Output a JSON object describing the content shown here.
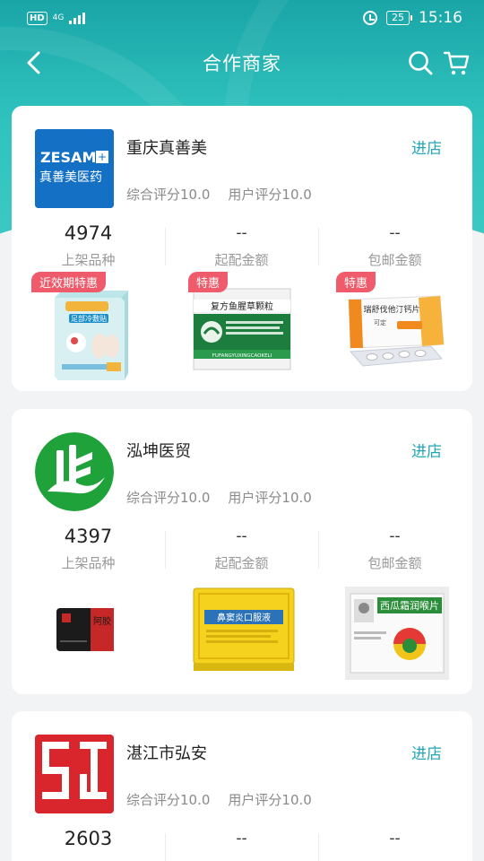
{
  "status_bar": {
    "hd": "HD",
    "network": "4G",
    "battery": "25",
    "time": "15:16"
  },
  "nav": {
    "title": "合作商家"
  },
  "stat_labels": {
    "products": "上架品种",
    "min_order": "起配金额",
    "free_shipping": "包邮金额"
  },
  "enter_label": "进店",
  "shops": [
    {
      "name": "重庆真善美",
      "logo_text_en": "ZESAM",
      "logo_text_cn": "真善美医药",
      "overall_rating": "综合评分10.0",
      "user_rating": "用户评分10.0",
      "product_count": "4974",
      "min_order": "--",
      "free_shipping": "--",
      "products": [
        {
          "tag": "近效期特惠",
          "label": "足部冷敷贴",
          "sub": "阿胶片"
        },
        {
          "tag": "特惠",
          "label": "复方鱼腥草颗粒",
          "sub": "FUFANGYUXINGCAOKELI"
        },
        {
          "tag": "特惠",
          "label": "瑞舒伐他汀钙片",
          "sub": "可定"
        }
      ]
    },
    {
      "name": "泓坤医贸",
      "overall_rating": "综合评分10.0",
      "user_rating": "用户评分10.0",
      "product_count": "4397",
      "min_order": "--",
      "free_shipping": "--",
      "products": [
        {
          "label": "阿胶"
        },
        {
          "label": "鼻窦炎口服液"
        },
        {
          "label": "西瓜霜润喉片"
        }
      ]
    },
    {
      "name": "湛江市弘安",
      "overall_rating": "综合评分10.0",
      "user_rating": "用户评分10.0",
      "product_count": "2603",
      "min_order": "--",
      "free_shipping": "--"
    }
  ],
  "colors": {
    "accent": "#22a6b3",
    "header_teal": "#2fc2bd",
    "promo_tag": "#ef5b6a",
    "zesam_blue": "#1470c4",
    "hongkun_green": "#1fa23a",
    "hongan_red": "#d9262c"
  }
}
